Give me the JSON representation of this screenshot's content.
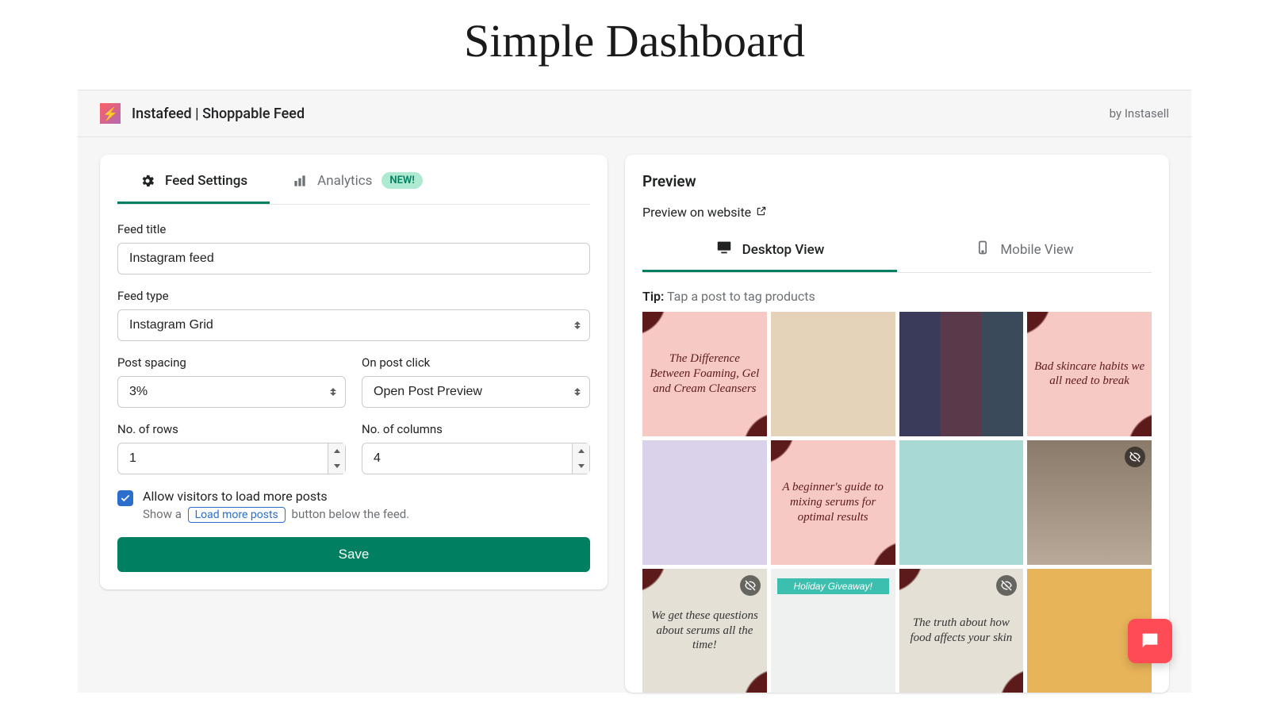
{
  "hero": {
    "title": "Simple Dashboard"
  },
  "app": {
    "logo_glyph": "⚡",
    "name": "Instafeed | Shoppable Feed",
    "credit": "by Instasell"
  },
  "settings": {
    "tabs": [
      {
        "label": "Feed Settings",
        "icon": "gear"
      },
      {
        "label": "Analytics",
        "icon": "bars",
        "badge": "NEW!"
      }
    ],
    "feed_title": {
      "label": "Feed title",
      "value": "Instagram feed"
    },
    "feed_type": {
      "label": "Feed type",
      "value": "Instagram Grid"
    },
    "post_spacing": {
      "label": "Post spacing",
      "value": "3%"
    },
    "on_post_click": {
      "label": "On post click",
      "value": "Open Post Preview"
    },
    "rows": {
      "label": "No. of rows",
      "value": "1"
    },
    "columns": {
      "label": "No. of columns",
      "value": "4"
    },
    "allow_more": {
      "label": "Allow visitors to load more posts",
      "help_before": "Show a",
      "chip": "Load more posts",
      "help_after": "button below the feed."
    },
    "save_label": "Save"
  },
  "preview": {
    "title": "Preview",
    "link": "Preview on website",
    "view_tabs": {
      "desktop": "Desktop View",
      "mobile": "Mobile View"
    },
    "tip_label": "Tip:",
    "tip_text": "Tap a post to tag products",
    "tiles": [
      {
        "text": "The Difference Between Foaming, Gel and Cream Cleansers",
        "bg": "#f7c9c4",
        "fg": "#5c1a1a",
        "corner": "#5c1a1a"
      },
      {
        "text": "",
        "bg": "#e4d3b8"
      },
      {
        "text": "",
        "bg": "#2b2b3a",
        "collage": true
      },
      {
        "text": "Bad skincare habits we all need to break",
        "bg": "#f7c9c4",
        "fg": "#5c1a1a",
        "corner": "#5c1a1a"
      },
      {
        "text": "",
        "bg": "#d9d2ea"
      },
      {
        "text": "A beginner's guide to mixing serums for optimal results",
        "bg": "#f7c9c4",
        "fg": "#5c1a1a",
        "corner": "#5c1a1a"
      },
      {
        "text": "",
        "bg": "#a9d9d4"
      },
      {
        "text": "",
        "bg": "#b9a998",
        "hidden": true,
        "meme": true
      },
      {
        "text": "We get these questions about serums all the time!",
        "bg": "#e5e0d6",
        "fg": "#333",
        "corner": "#5c1a1a",
        "hidden": true
      },
      {
        "text": "Holiday Giveaway!",
        "bg": "#eff1f0",
        "banner": "#3cbfae"
      },
      {
        "text": "The truth about how food affects your skin",
        "bg": "#e5e0d6",
        "fg": "#333",
        "corner": "#5c1a1a",
        "hidden": true
      },
      {
        "text": "",
        "bg": "#e8b45a"
      }
    ]
  },
  "chat": {
    "icon": "speech"
  }
}
